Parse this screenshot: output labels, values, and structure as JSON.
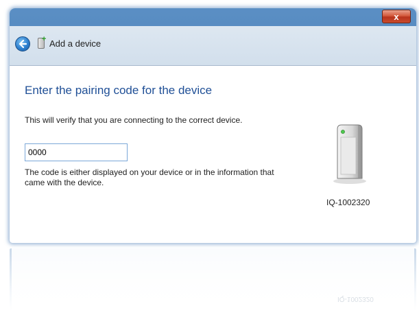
{
  "window": {
    "close_label": "x"
  },
  "header": {
    "title": "Add a device",
    "back_icon": "back-arrow-icon",
    "device_icon": "add-device-icon"
  },
  "main": {
    "heading": "Enter the pairing code for the device",
    "verify_text": "This will verify that you are connecting to the correct device.",
    "code_input": {
      "value": "0000"
    },
    "hint_text": "The code is either displayed on your device or in the information that came with the device.",
    "device": {
      "icon": "device-tower-icon",
      "label": "IQ-1002320"
    }
  },
  "reflection": {
    "label": "IQ-1002320"
  },
  "colors": {
    "accent": "#1f4f96",
    "title_bar": "#3e76b3",
    "close_button": "#c84a2c"
  }
}
